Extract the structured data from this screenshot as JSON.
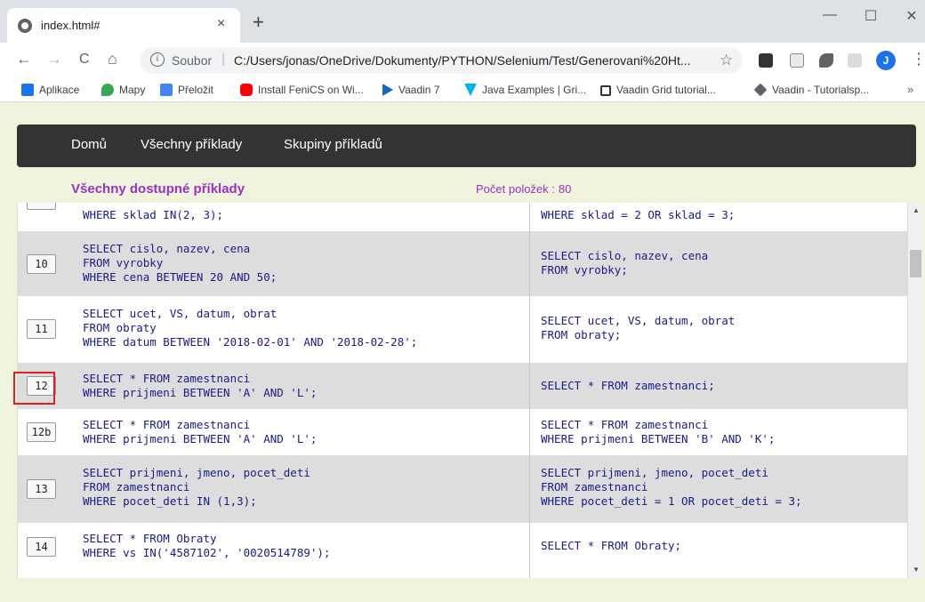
{
  "browser": {
    "tab_title": "index.html#",
    "tab_close": "×",
    "new_tab": "+",
    "window": {
      "minimize": "—",
      "maximize": "☐",
      "close": "✕"
    },
    "nav": {
      "back": "←",
      "forward": "→",
      "reload": "C",
      "home": "⌂"
    },
    "omnibox": {
      "scheme_label": "Soubor",
      "separator": "|",
      "url": "C:/Users/jonas/OneDrive/Dokumenty/PYTHON/Selenium/Test/Generovani%20Ht..."
    },
    "star": "☆",
    "avatar": "J",
    "menu": "⋮",
    "bookmarks": [
      {
        "label": "Aplikace",
        "icon": "apps-grid-icon",
        "color": "#1a73e8"
      },
      {
        "label": "Mapy",
        "icon": "maps-pin-icon",
        "color": "#34a853"
      },
      {
        "label": "Přeložit",
        "icon": "translate-icon",
        "color": "#4285f4"
      },
      {
        "label": "Install FeniCS on Wi...",
        "icon": "youtube-icon",
        "color": "#ff0000"
      },
      {
        "label": "Vaadin 7",
        "icon": "play-triangle-icon",
        "color": "#1565c0"
      },
      {
        "label": "Java Examples | Gri...",
        "icon": "vaadin-v-icon",
        "color": "#00b4f0"
      },
      {
        "label": "Vaadin Grid tutorial...",
        "icon": "square-icon",
        "color": "#333333"
      },
      {
        "label": "Vaadin - Tutorialsp...",
        "icon": "diamond-icon",
        "color": "#5f6368"
      }
    ],
    "bookmarks_more": "»"
  },
  "navbar": {
    "items": [
      {
        "label": "Domů"
      },
      {
        "label": "Všechny příklady"
      },
      {
        "label": "Skupiny příkladů"
      }
    ]
  },
  "header": {
    "title": "Všechny dostupné příklady",
    "count_label": "Počet položek :",
    "count_value": "80"
  },
  "examples": [
    {
      "number": "",
      "query_a": "WHERE sklad IN(2, 3);",
      "query_b": "WHERE sklad = 2 OR sklad = 3;"
    },
    {
      "number": "10",
      "query_a": "SELECT cislo, nazev, cena\nFROM vyrobky\nWHERE cena BETWEEN 20 AND 50;",
      "query_b": "SELECT cislo, nazev, cena\nFROM vyrobky;"
    },
    {
      "number": "11",
      "query_a": "SELECT ucet, VS, datum, obrat\nFROM obraty\nWHERE datum BETWEEN '2018-02-01' AND '2018-02-28';",
      "query_b": "SELECT ucet, VS, datum, obrat\nFROM obraty;"
    },
    {
      "number": "12",
      "query_a": "SELECT * FROM zamestnanci\nWHERE prijmeni BETWEEN 'A' AND 'L';",
      "query_b": "SELECT * FROM zamestnanci;"
    },
    {
      "number": "12b",
      "query_a": "SELECT * FROM zamestnanci\nWHERE prijmeni BETWEEN 'A' AND 'L';",
      "query_b": "SELECT * FROM zamestnanci\nWHERE prijmeni BETWEEN 'B' AND 'K';"
    },
    {
      "number": "13",
      "query_a": "SELECT prijmeni, jmeno, pocet_deti\nFROM zamestnanci\nWHERE pocet_deti IN (1,3);",
      "query_b": "SELECT prijmeni, jmeno, pocet_deti\nFROM zamestnanci\nWHERE pocet_deti = 1 OR pocet_deti = 3;"
    },
    {
      "number": "14",
      "query_a": "SELECT * FROM Obraty\nWHERE vs IN('4587102', '0020514789');",
      "query_b": "SELECT * FROM Obraty;"
    }
  ],
  "colors": {
    "page_bg": "#f0f4dc",
    "navbar_bg": "#333333",
    "title_color": "#9b30c8",
    "code_color": "#1a1a8c",
    "highlight": "#e02020"
  }
}
